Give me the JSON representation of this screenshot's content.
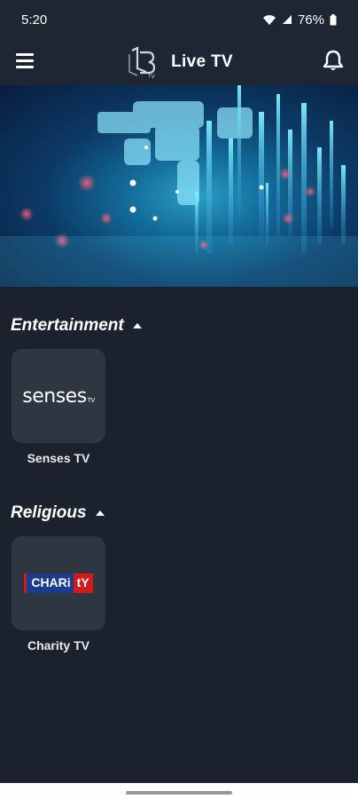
{
  "status_bar": {
    "time": "5:20",
    "battery": "76%",
    "icons": [
      "wifi-icon",
      "signal-icon",
      "battery-icon"
    ]
  },
  "app_bar": {
    "title": "Live TV",
    "logo_text": "LB",
    "logo_sub": "TV",
    "menu_icon": "hamburger-menu-icon",
    "bell_icon": "bell-icon"
  },
  "sections": [
    {
      "title": "Entertainment",
      "channels": [
        {
          "name": "Senses TV",
          "logo_text": "senses",
          "logo_sub": "TV"
        }
      ]
    },
    {
      "title": "Religious",
      "channels": [
        {
          "name": "Charity TV",
          "logo_left": "CHARi",
          "logo_right": "tY"
        }
      ]
    }
  ],
  "colors": {
    "background": "#1b222d",
    "app_bar": "#1f2633",
    "tile": "#2e3642",
    "charity_blue": "#1b3b8f",
    "charity_red": "#d11a1a"
  }
}
